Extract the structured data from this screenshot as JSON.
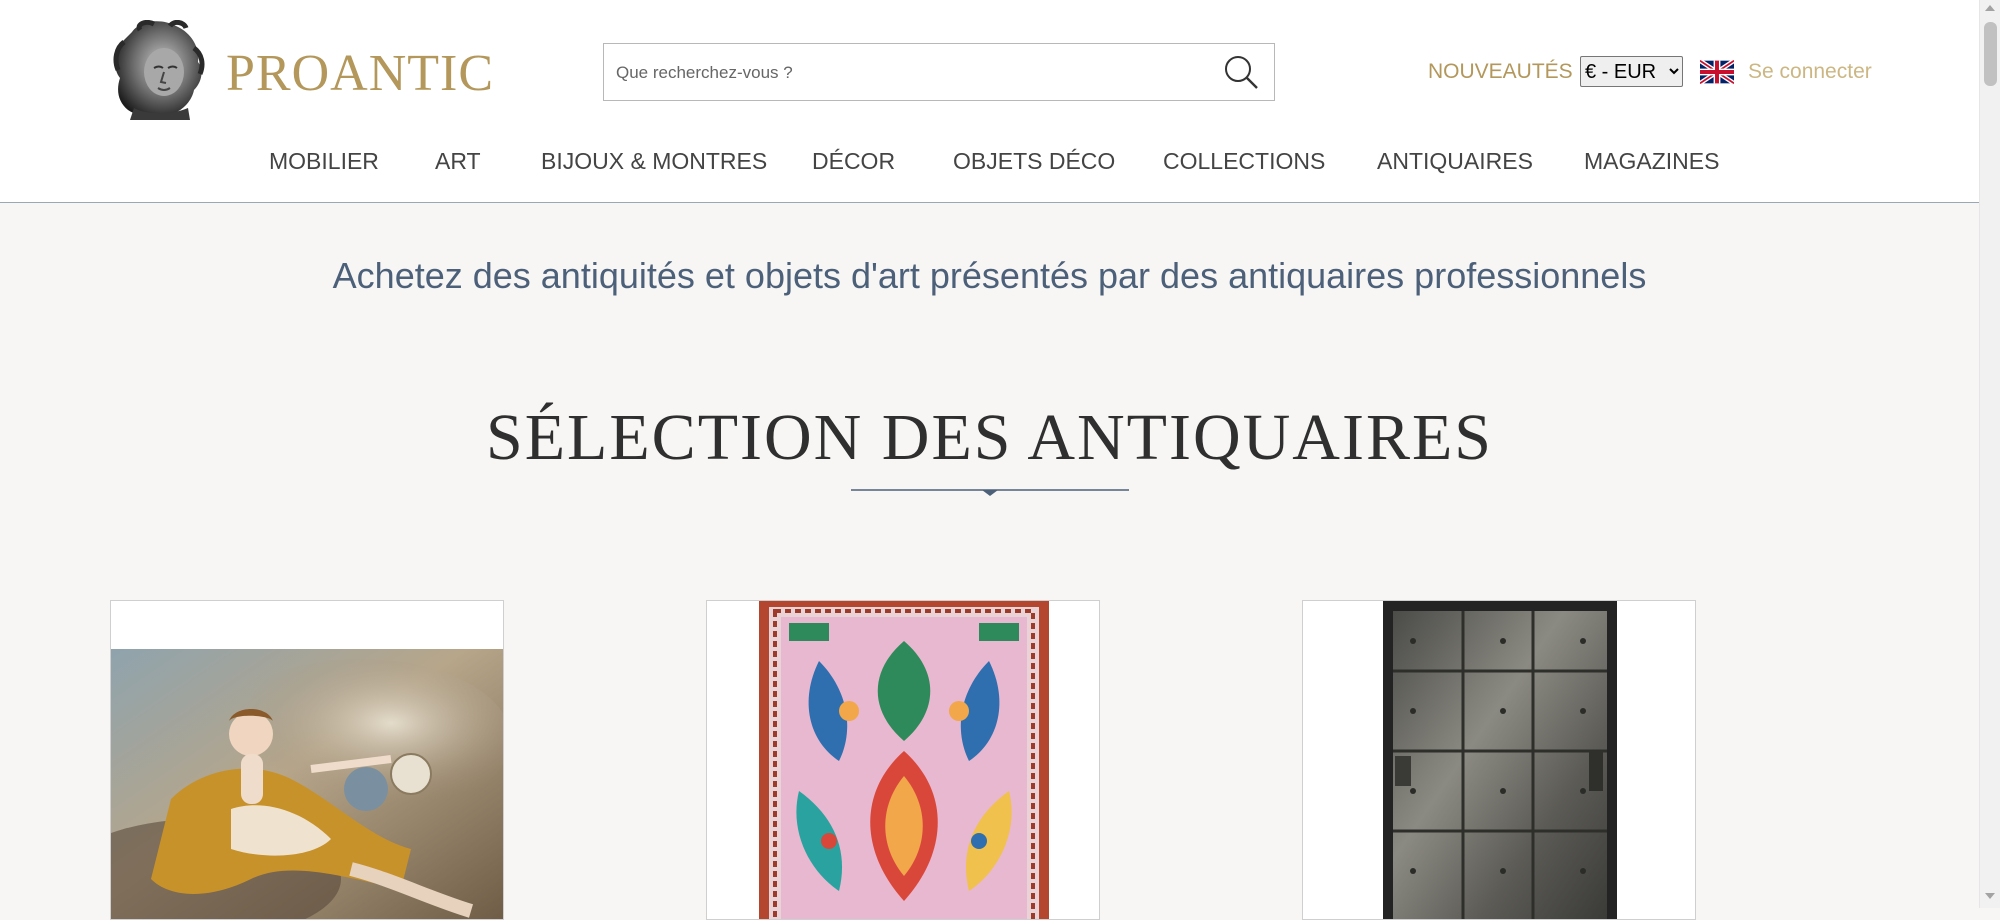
{
  "brand": {
    "name": "PROANTIC",
    "color": "#b3975b"
  },
  "search": {
    "placeholder": "Que recherchez-vous ?",
    "icon": "search-icon"
  },
  "header_links": {
    "nouveautes": "NOUVEAUTÉS",
    "currency_selected": "€ - EUR",
    "language_flag": "uk-flag-icon",
    "login": "Se connecter"
  },
  "nav": {
    "items": [
      {
        "label": "MOBILIER"
      },
      {
        "label": "ART"
      },
      {
        "label": "BIJOUX & MONTRES"
      },
      {
        "label": "DÉCOR"
      },
      {
        "label": "OBJETS DÉCO"
      },
      {
        "label": "COLLECTIONS"
      },
      {
        "label": "ANTIQUAIRES"
      },
      {
        "label": "MAGAZINES"
      }
    ]
  },
  "main": {
    "tagline": "Achetez des antiquités et objets d'art présentés par des antiquaires professionnels",
    "section_title": "SÉLECTION DES ANTIQUAIRES",
    "cards": [
      {
        "image": "rococo-painting-reclining-woman"
      },
      {
        "image": "oriental-rug-pink-pattern"
      },
      {
        "image": "antique-iron-door"
      }
    ]
  }
}
